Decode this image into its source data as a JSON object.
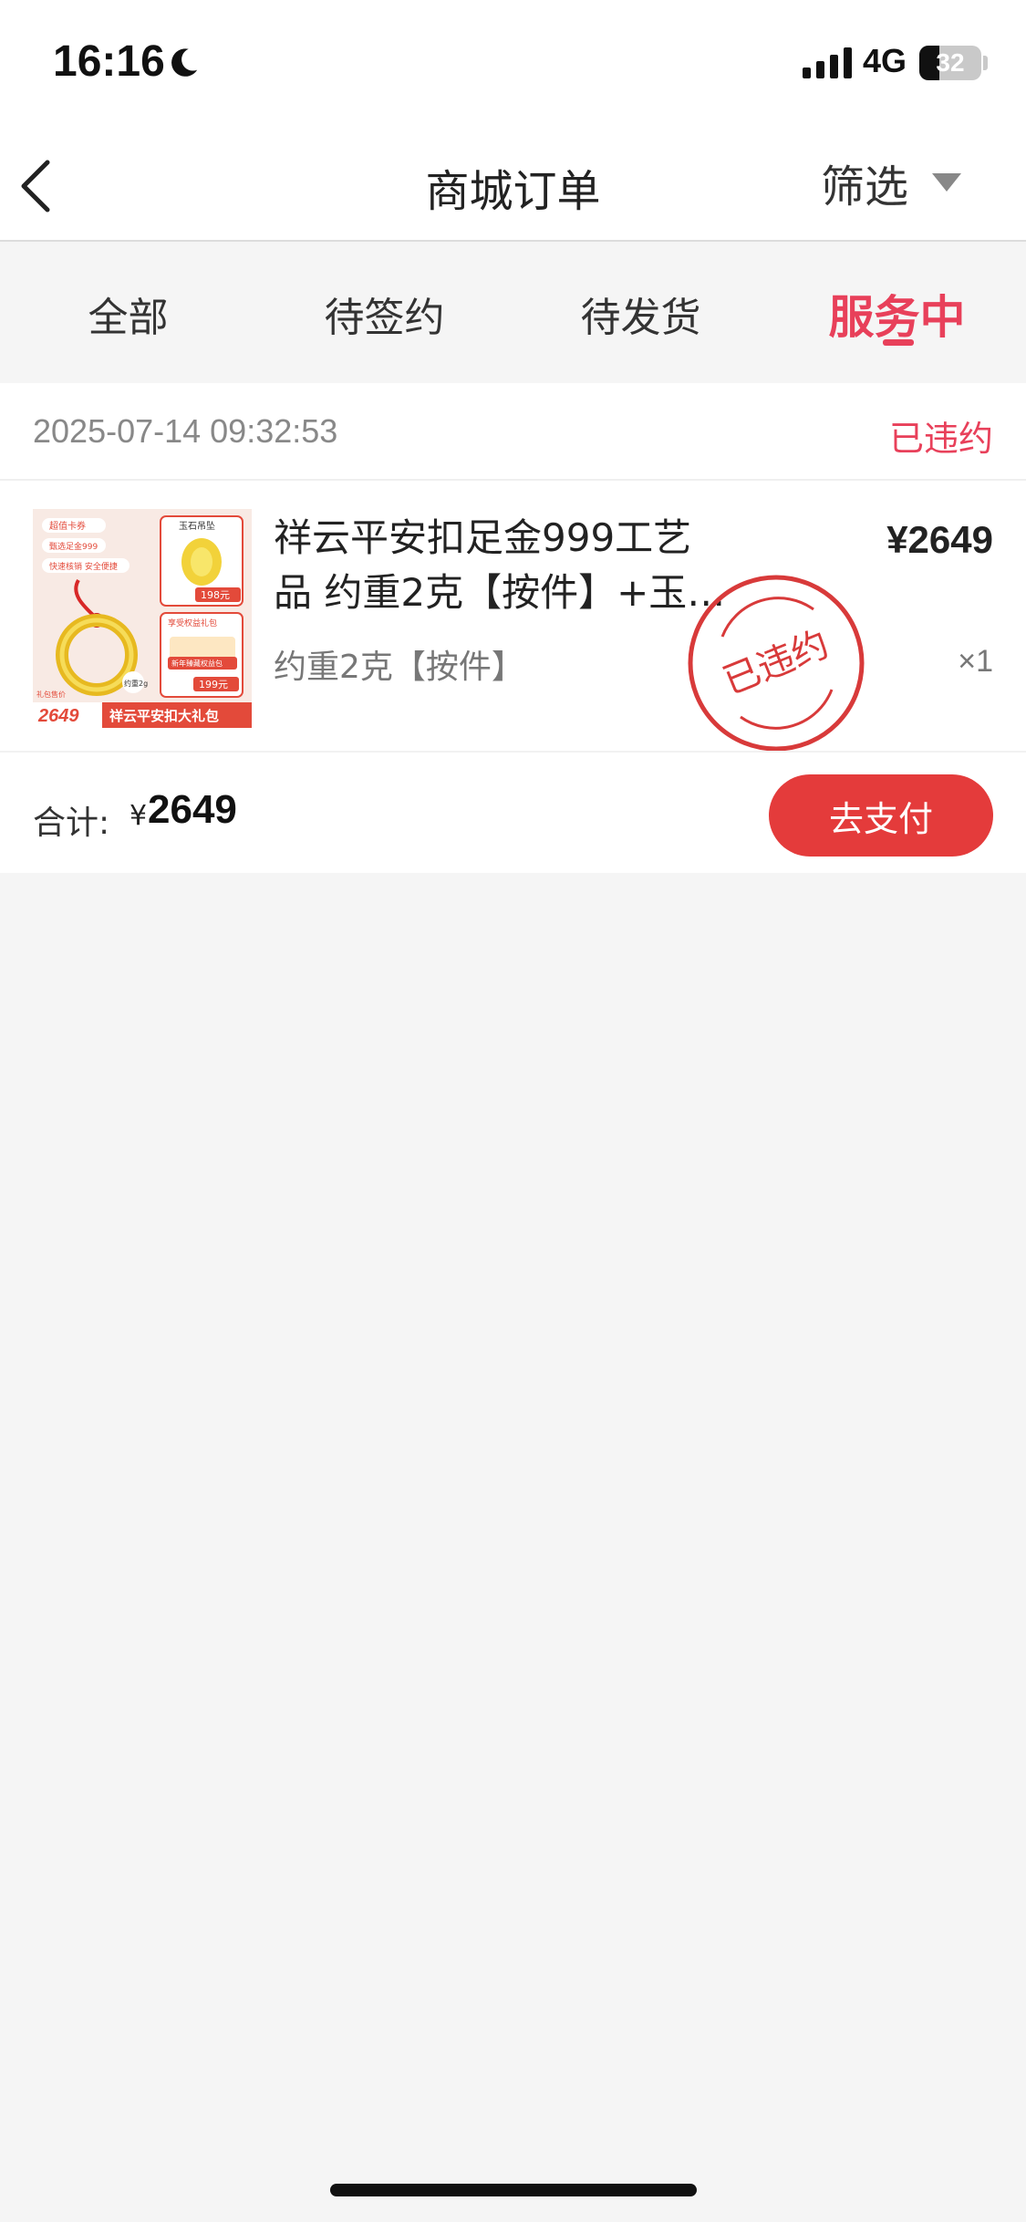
{
  "status_bar": {
    "time": "16:16",
    "network": "4G",
    "battery_level": "32",
    "battery_fraction": 0.32
  },
  "nav": {
    "title": "商城订单",
    "filter_label": "筛选"
  },
  "tabs": [
    {
      "label": "全部"
    },
    {
      "label": "待签约"
    },
    {
      "label": "待发货"
    },
    {
      "label": "服务中",
      "active": true
    }
  ],
  "order": {
    "time": "2025-07-14 09:32:53",
    "status": "已违约",
    "product": {
      "title": "祥云平安扣足金999工艺品 约重2克【按件】+玉…",
      "price": "¥2649",
      "spec": "约重2克【按件】",
      "quantity": "×1",
      "stamp_text": "已违约",
      "image": {
        "badge_1": "超值卡券",
        "badge_2": "甄选足金999",
        "badge_3": "快速核销 安全便捷",
        "pendant_label": "玉石吊坠",
        "pendant_price": "198元",
        "gift_label": "享受权益礼包",
        "gift_sub": "新年臻藏权益包",
        "gift_price": "199元",
        "weight": "约重2g",
        "bottom_price": "2649",
        "bottom_title": "祥云平安扣大礼包",
        "price_label": "礼包售价"
      }
    },
    "total_label": "合计:",
    "total_currency": "¥",
    "total_amount": "2649",
    "pay_button": "去支付"
  },
  "colors": {
    "accent": "#e8405a",
    "pay_button": "#e43b3b",
    "stamp": "#d83a3a"
  }
}
